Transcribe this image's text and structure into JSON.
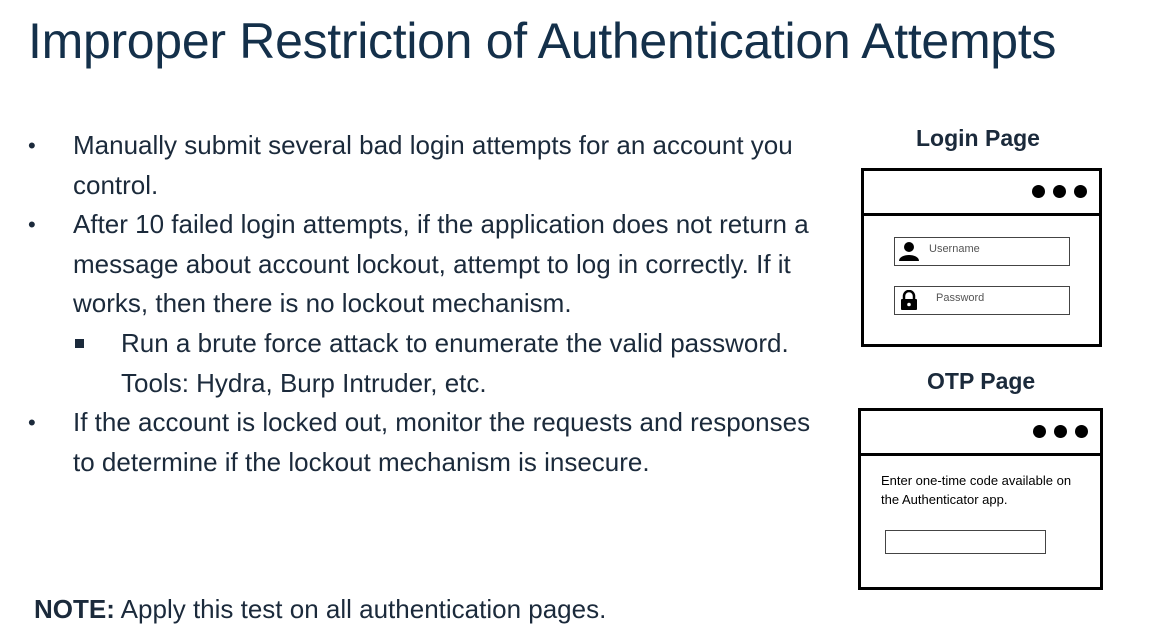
{
  "slide": {
    "title": "Improper Restriction of Authentication Attempts",
    "bullets": [
      {
        "text": "Manually submit several bad login attempts for an account you control."
      },
      {
        "text": "After 10 failed login attempts, if the application does not return a message about account lockout, attempt to log in correctly. If it works, then there is no lockout mechanism."
      },
      {
        "text": "If the account is locked out, monitor the requests and responses to determine if the lockout mechanism is insecure."
      }
    ],
    "sub_bullet": "Run a brute force attack to enumerate the valid password. Tools: Hydra, Burp Intruder, etc.",
    "bullet_marker": "•",
    "note_label": "NOTE:",
    "note_text": " Apply this test on all authentication pages."
  },
  "login_panel": {
    "title": "Login Page",
    "username_placeholder": "Username",
    "password_placeholder": "Password",
    "icons": [
      "user-icon",
      "lock-icon"
    ]
  },
  "otp_panel": {
    "title": "OTP Page",
    "instruction": "Enter one-time code available on the Authenticator app."
  },
  "colors": {
    "title": "#14304a",
    "body_text": "#1b2a3b",
    "wireframe": "#000000"
  }
}
